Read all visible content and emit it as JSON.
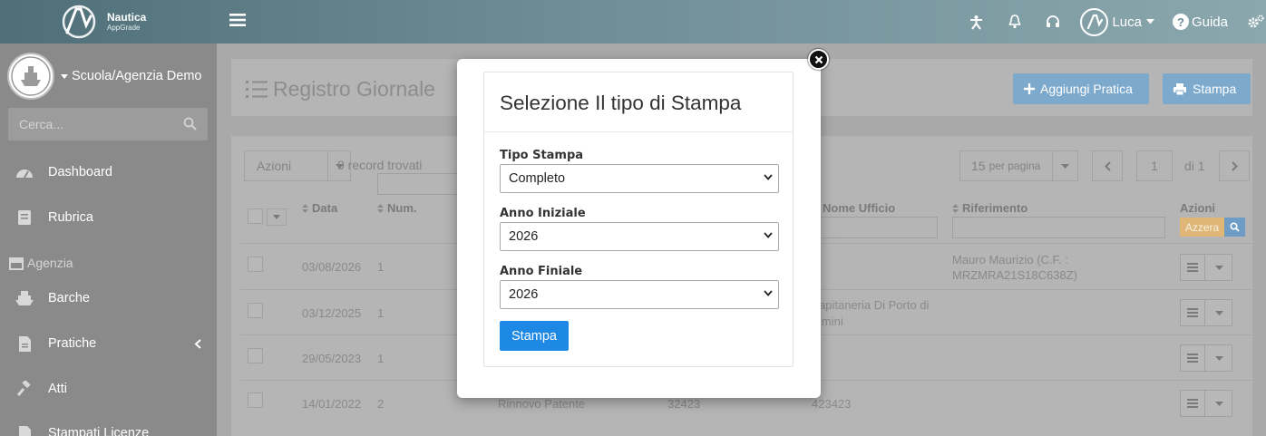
{
  "brand": {
    "name": "Nautica",
    "sub": "AppGrade"
  },
  "topbar": {
    "user_name": "Luca",
    "help_label": "Guida"
  },
  "sidebar": {
    "school_name": "Scuola/Agenzia Demo",
    "search_placeholder": "Cerca...",
    "items": [
      {
        "label": "Dashboard",
        "icon": "dashboard-icon"
      },
      {
        "label": "Rubrica",
        "icon": "addressbook-icon"
      }
    ],
    "section_agenzia": "Agenzia",
    "agency_items": [
      {
        "label": "Barche",
        "icon": "ship-icon"
      },
      {
        "label": "Pratiche",
        "icon": "file-icon"
      },
      {
        "label": "Atti",
        "icon": "gavel-icon"
      },
      {
        "label": "Stampati Licenze",
        "icon": "document-icon"
      }
    ]
  },
  "page": {
    "title": "Registro Giornale",
    "add_button": "Aggiungi Pratica",
    "print_button": "Stampa"
  },
  "list": {
    "actions_label": "Azioni",
    "record_count": "9 record trovati",
    "per_page_num": "15",
    "per_page_text": "per pagina",
    "page_number": "1",
    "page_total": "di 1",
    "columns": {
      "data": "Data",
      "num": "Num.",
      "nome_ufficio": "Nome Ufficio",
      "riferimento": "Riferimento",
      "azioni": "Azioni"
    },
    "reset_label": "Azzera",
    "rows": [
      {
        "date": "03/08/2026",
        "num": "1",
        "col3": "",
        "col4": "",
        "ufficio": "",
        "rif": "Mauro Maurizio (C.F. : MRZMRA21S18C638Z)"
      },
      {
        "date": "03/12/2025",
        "num": "1",
        "col3": "",
        "col4": "",
        "ufficio": "apitaneria Di Porto di imini",
        "rif": ""
      },
      {
        "date": "29/05/2023",
        "num": "1",
        "col3": "",
        "col4": "",
        "ufficio": "",
        "rif": ""
      },
      {
        "date": "14/01/2022",
        "num": "2",
        "col3": "Rinnovo Patente",
        "col4": "32423",
        "ufficio": "423423",
        "rif": ""
      }
    ]
  },
  "modal": {
    "title": "Selezione Il tipo di Stampa",
    "tipo_label": "Tipo Stampa",
    "tipo_value": "Completo",
    "anno_iniziale_label": "Anno Iniziale",
    "anno_iniziale_value": "2026",
    "anno_finale_label": "Anno Finiale",
    "anno_finale_value": "2026",
    "print_button": "Stampa"
  },
  "colors": {
    "primary": "#1e88e5",
    "topbar": "#6f8d96",
    "sidebar": "#8a8a8a",
    "overlay_btn": "#7ca9cc",
    "reset_btn": "#f0c27b"
  }
}
